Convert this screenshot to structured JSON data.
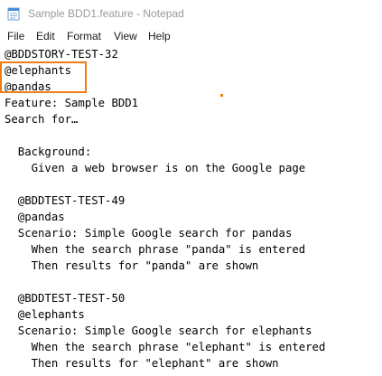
{
  "window": {
    "title": "Sample BDD1.feature - Notepad",
    "app_icon": "notepad-icon",
    "accent_color": "#f07c12"
  },
  "menu": {
    "items": [
      "File",
      "Edit",
      "Format",
      "View",
      "Help"
    ]
  },
  "editor": {
    "lines": [
      "@BDDSTORY-TEST-32",
      "@elephants",
      "@pandas",
      "Feature: Sample BDD1",
      "Search for…",
      "",
      "  Background:",
      "    Given a web browser is on the Google page",
      "",
      "  @BDDTEST-TEST-49",
      "  @pandas",
      "  Scenario: Simple Google search for pandas",
      "    When the search phrase \"panda\" is entered",
      "    Then results for \"panda\" are shown",
      "",
      "  @BDDTEST-TEST-50",
      "  @elephants",
      "  Scenario: Simple Google search for elephants",
      "    When the search phrase \"elephant\" is entered",
      "    Then results for \"elephant\" are shown"
    ]
  }
}
